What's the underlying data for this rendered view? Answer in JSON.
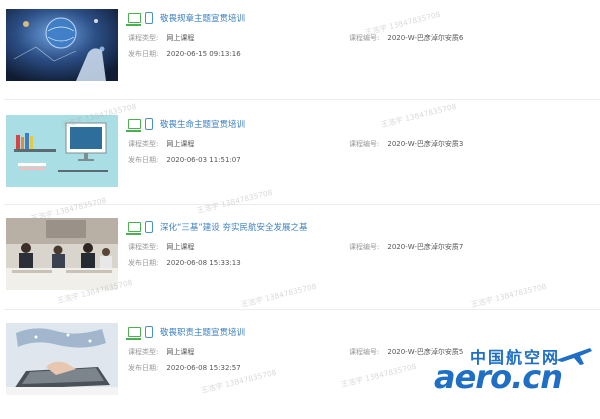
{
  "courses": [
    {
      "title": "敬畏规章主题宣贯培训",
      "type_label": "课程类型:",
      "type_value": "网上课程",
      "date_label": "发布日期:",
      "date_value": "2020-06-15 09:13:16",
      "code_label": "课程编号:",
      "code_value": "2020-W-巴彦淖尔安质6"
    },
    {
      "title": "敬畏生命主题宣贯培训",
      "type_label": "课程类型:",
      "type_value": "网上课程",
      "date_label": "发布日期:",
      "date_value": "2020-06-03 11:51:07",
      "code_label": "课程编号:",
      "code_value": "2020-W-巴彦淖尔安质3"
    },
    {
      "title": "深化“三基”建设 夯实民航安全发展之基",
      "type_label": "课程类型:",
      "type_value": "网上课程",
      "date_label": "发布日期:",
      "date_value": "2020-06-08 15:33:13",
      "code_label": "课程编号:",
      "code_value": "2020-W-巴彦淖尔安质7"
    },
    {
      "title": "敬畏职责主题宣贯培训",
      "type_label": "课程类型:",
      "type_value": "网上课程",
      "date_label": "发布日期:",
      "date_value": "2020-06-08 15:32:57",
      "code_label": "课程编号:",
      "code_value": "2020-W-巴彦淖尔安质5"
    }
  ],
  "watermark": "王浩宇 13847835708",
  "logo": {
    "cn": "中国航空网",
    "en": "aero.cn"
  },
  "colors": {
    "title": "#3b7fc1",
    "pc_icon": "#4caf50",
    "mobile_icon": "#4a90c8",
    "logo": "#1f6fc4"
  }
}
